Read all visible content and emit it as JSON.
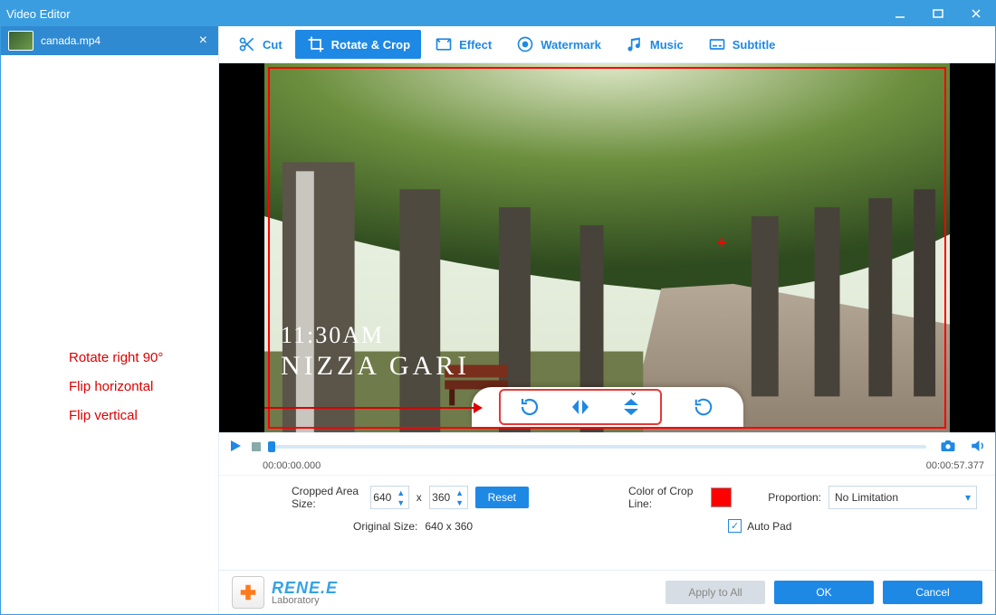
{
  "window": {
    "title": "Video Editor"
  },
  "file": {
    "name": "canada.mp4"
  },
  "annotations": {
    "rotate": "Rotate right 90°",
    "fliph": "Flip horizontal",
    "flipv": "Flip vertical"
  },
  "tabs": {
    "cut": "Cut",
    "rotate": "Rotate & Crop",
    "effect": "Effect",
    "watermark": "Watermark",
    "music": "Music",
    "subtitle": "Subtitle"
  },
  "overlay": {
    "time": "11:30AM",
    "place": "NIZZA GARI"
  },
  "transport": {
    "current": "00:00:00.000",
    "total": "00:00:57.377"
  },
  "settings": {
    "crop_label": "Cropped Area Size:",
    "w": "640",
    "x": "x",
    "h": "360",
    "reset": "Reset",
    "orig_label": "Original Size:",
    "orig_value": "640 x 360",
    "color_label": "Color of Crop Line:",
    "prop_label": "Proportion:",
    "prop_value": "No Limitation",
    "autopad": "Auto Pad"
  },
  "footer": {
    "brand1": "RENE.E",
    "brand2": "Laboratory",
    "apply": "Apply to All",
    "ok": "OK",
    "cancel": "Cancel"
  }
}
